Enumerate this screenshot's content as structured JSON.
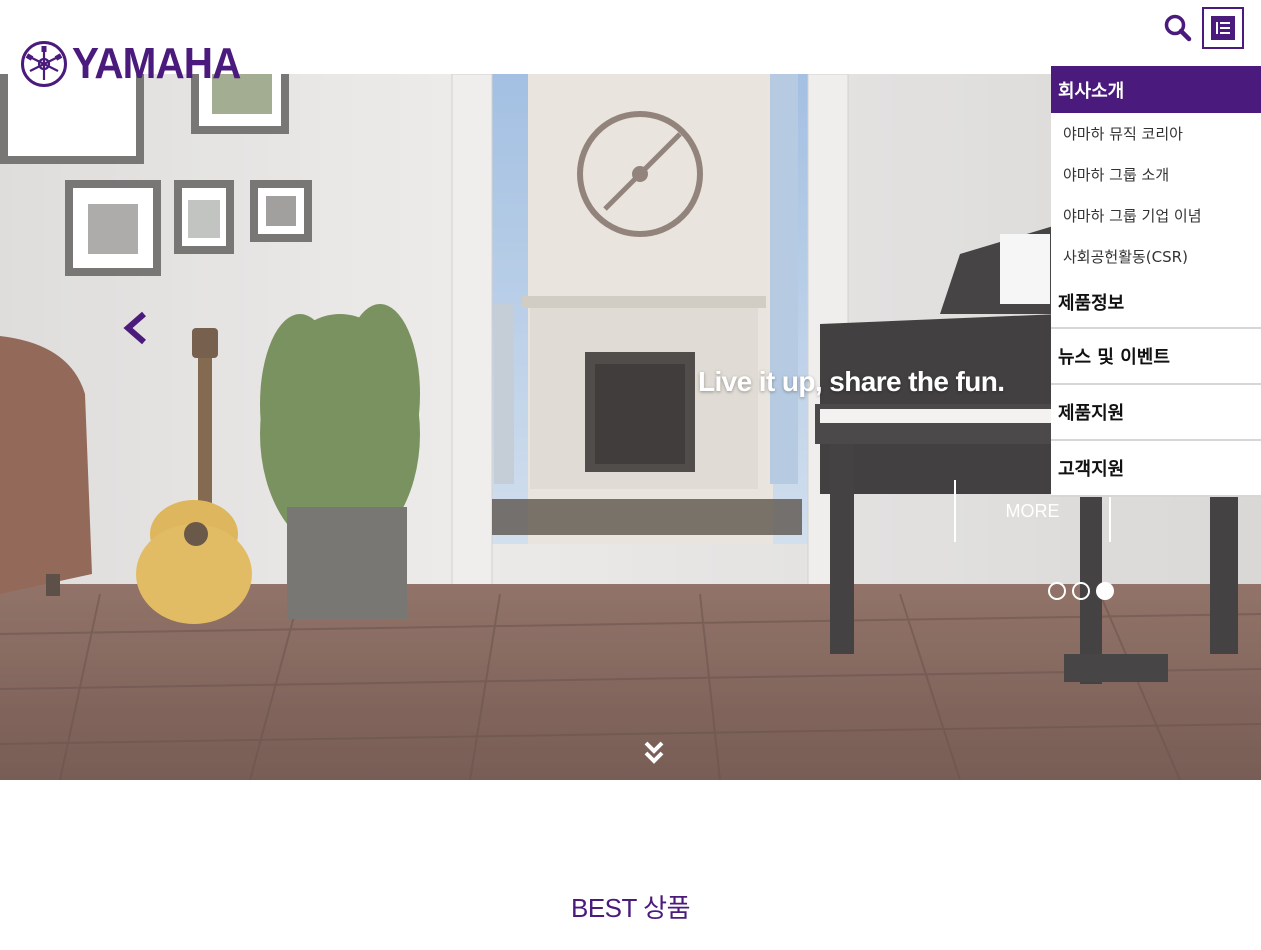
{
  "brand": {
    "name": "YAMAHA",
    "color": "#4a1a7c"
  },
  "header": {
    "search_icon": "search-icon",
    "menu_icon": "menu-icon"
  },
  "hero": {
    "headline": "Live it up, share the fun.",
    "more_label": "MORE",
    "prev_icon": "chevron-left-icon",
    "scroll_icon": "double-chevron-down-icon",
    "slides": {
      "count": 3,
      "active_index": 2
    }
  },
  "sidenav": {
    "active_section": "회사소개",
    "sub_items": [
      "야마하 뮤직 코리아",
      "야마하 그룹 소개",
      "야마하 그룹 기업 이념",
      "사회공헌활동(CSR)"
    ],
    "items": [
      "제품정보",
      "뉴스 및 이벤트",
      "제품지원",
      "고객지원"
    ]
  },
  "sections": {
    "best_title": "BEST 상품"
  }
}
